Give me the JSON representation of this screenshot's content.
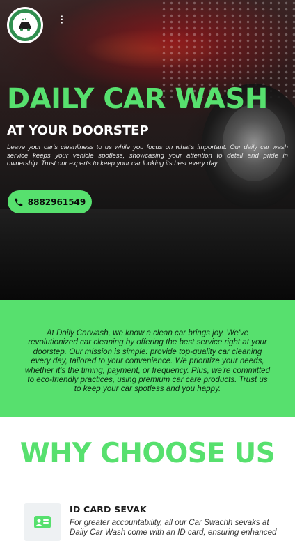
{
  "brand": {
    "icon": "car-wash-logo-icon",
    "accent": "#57e06e"
  },
  "header": {
    "menu_icon": "menu-icon"
  },
  "hero": {
    "title": "DAILY CAR WASH",
    "subtitle": "AT YOUR DOORSTEP",
    "description": "Leave your car's cleanliness to us while you focus on what's important. Our daily car wash service keeps your vehicle spotless, showcasing your attention to detail and pride in ownership. Trust our experts to keep your car looking its best every day.",
    "phone_label": "8882961549",
    "phone_icon": "phone-icon"
  },
  "about": {
    "text": "At Daily Carwash, we know a clean car brings joy. We've revolutionized car cleaning by offering the best service right at your doorstep. Our mission is simple: provide top-quality car cleaning every day, tailored to your convenience. We prioritize your needs, whether it's the timing, payment, or frequency. Plus, we're committed to eco-friendly practices, using premium car care products. Trust us to keep your car spotless and you happy."
  },
  "why": {
    "title": "WHY CHOOSE US",
    "features": [
      {
        "icon": "id-card-icon",
        "title": "ID CARD SEVAK",
        "description": "For greater accountability, all our Car Swachh sevaks at Daily Car Wash come with an ID card, ensuring enhanced"
      }
    ]
  }
}
